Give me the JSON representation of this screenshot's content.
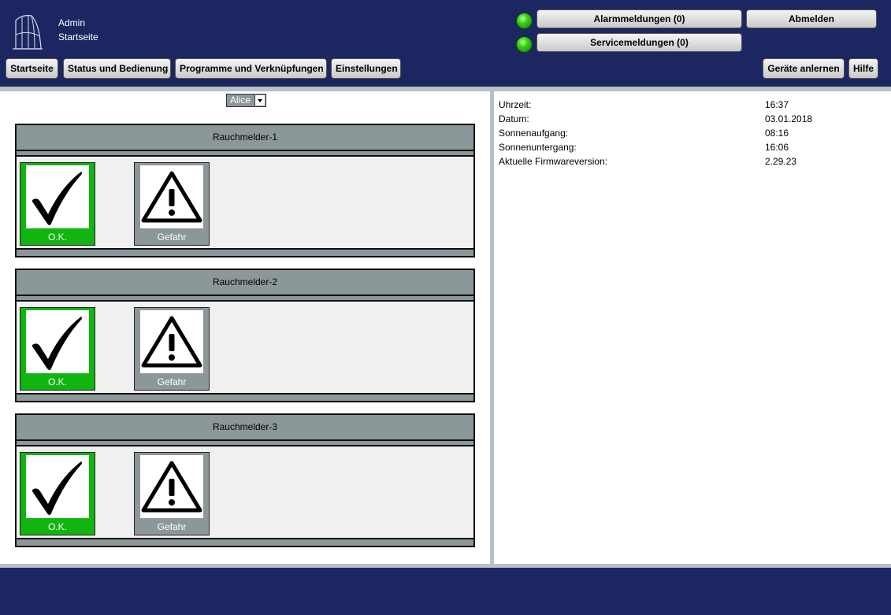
{
  "header": {
    "user": "Admin",
    "page": "Startseite",
    "alarm_label": "Alarmmeldungen (0)",
    "service_label": "Servicemeldungen (0)",
    "logout_label": "Abmelden"
  },
  "nav": {
    "home": "Startseite",
    "status": "Status und Bedienung",
    "programs": "Programme und Verknüpfungen",
    "settings": "Einstellungen",
    "teach": "Geräte anlernen",
    "help": "Hilfe"
  },
  "favorites": {
    "selected": "Alice"
  },
  "devices": [
    {
      "name": "Rauchmelder-1",
      "ok_label": "O.K.",
      "danger_label": "Gefahr"
    },
    {
      "name": "Rauchmelder-2",
      "ok_label": "O.K.",
      "danger_label": "Gefahr"
    },
    {
      "name": "Rauchmelder-3",
      "ok_label": "O.K.",
      "danger_label": "Gefahr"
    }
  ],
  "info": [
    {
      "label": "Uhrzeit:",
      "value": "16:37"
    },
    {
      "label": "Datum:",
      "value": "03.01.2018"
    },
    {
      "label": "Sonnenaufgang:",
      "value": "08:16"
    },
    {
      "label": "Sonnenuntergang:",
      "value": "16:06"
    },
    {
      "label": "Aktuelle Firmwareversion:",
      "value": "2.29.23"
    }
  ],
  "icons": {
    "logo": "logo-icon",
    "alarm_status": "green-led-icon",
    "service_status": "green-led-icon",
    "ok": "checkmark-icon",
    "danger": "warning-triangle-icon"
  },
  "colors": {
    "header_bg": "#1c2660",
    "ok_tile": "#11b411",
    "danger_tile": "#8c979a",
    "led": "#39d417"
  }
}
